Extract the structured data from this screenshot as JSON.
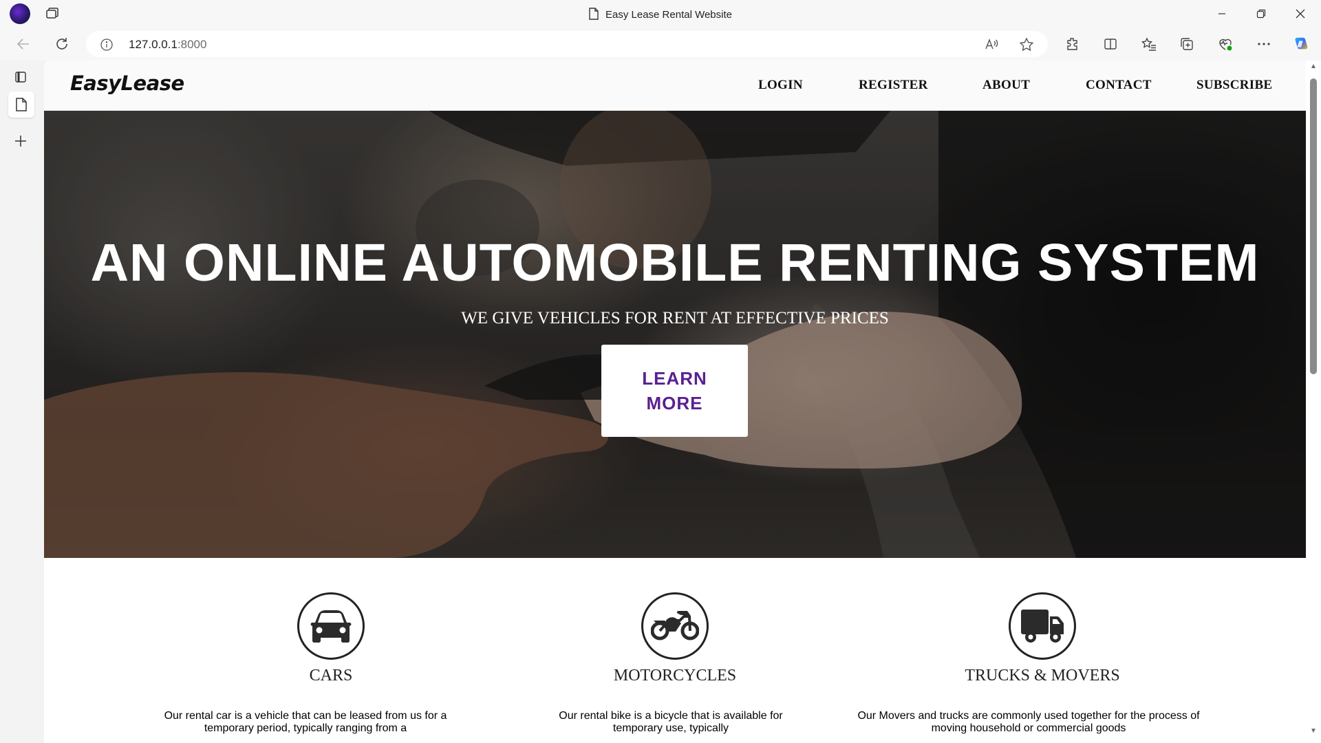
{
  "browser": {
    "window_title": "Easy Lease Rental Website",
    "url_host": "127.0.0.1",
    "url_port": ":8000"
  },
  "site": {
    "logo": "EasyLease",
    "nav": [
      "LOGIN",
      "REGISTER",
      "ABOUT",
      "CONTACT",
      "SUBSCRIBE"
    ]
  },
  "hero": {
    "title": "AN ONLINE AUTOMOBILE RENTING SYSTEM",
    "subtitle": "WE GIVE VEHICLES FOR RENT AT EFFECTIVE PRICES",
    "cta": "LEARN MORE"
  },
  "services": [
    {
      "name": "CARS",
      "icon": "car-icon",
      "desc": "Our rental car is a vehicle that can be leased from us for a temporary period, typically ranging from a"
    },
    {
      "name": "MOTORCYCLES",
      "icon": "motorcycle-icon",
      "desc": "Our rental bike is a bicycle that is available for temporary use, typically"
    },
    {
      "name": "TRUCKS & MOVERS",
      "icon": "truck-icon",
      "desc": "Our Movers and trucks are commonly used together for the process of moving household or commercial goods"
    }
  ]
}
